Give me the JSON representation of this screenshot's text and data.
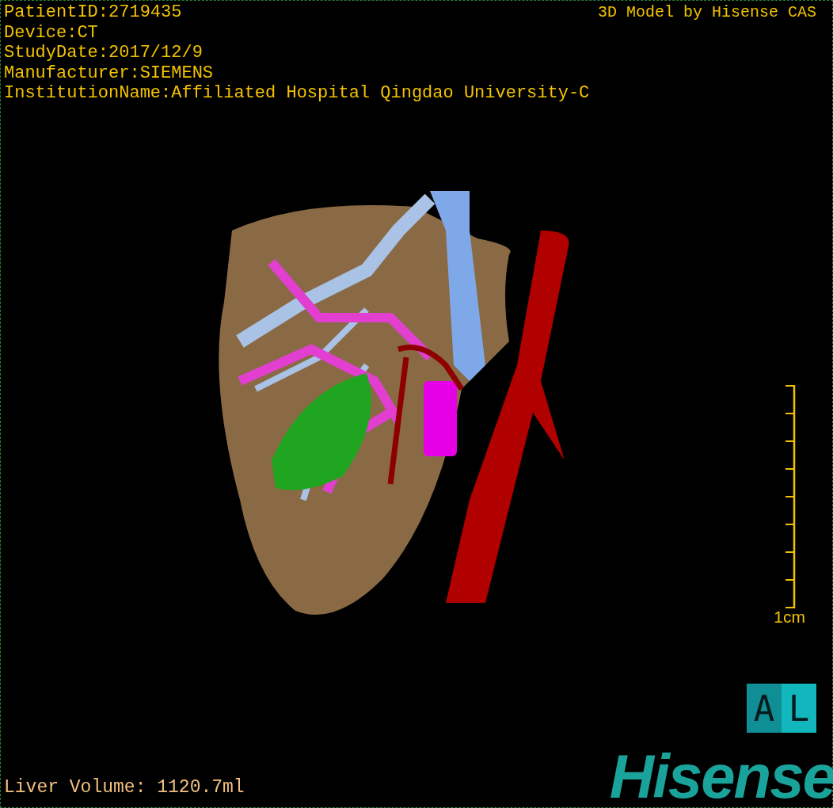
{
  "patient_info": [
    "PatientID:2719435",
    "Device:CT",
    "StudyDate:2017/12/9",
    "Manufacturer:SIEMENS",
    "InstitutionName:Affiliated Hospital Qingdao University-C"
  ],
  "title": "3D Model by Hisense CAS",
  "scale": {
    "label": "1cm"
  },
  "orientation_marker": {
    "faces": [
      "A",
      "L"
    ]
  },
  "liver_volume": "Liver Volume: 1120.7ml",
  "logo": "Hisense"
}
